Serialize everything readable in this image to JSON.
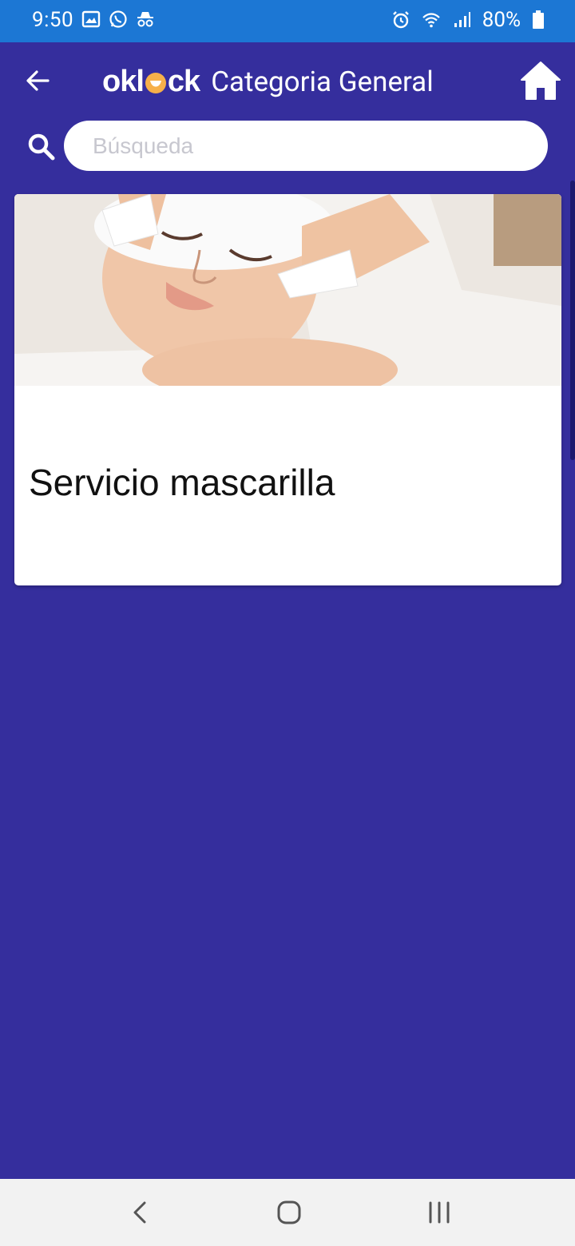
{
  "status_bar": {
    "time": "9:50",
    "battery": "80%",
    "left_icons": [
      "gallery-icon",
      "whatsapp-icon",
      "incognito-icon"
    ],
    "right_icons": [
      "alarm-icon",
      "wifi-icon",
      "signal-icon",
      "battery-icon"
    ]
  },
  "header": {
    "logo_text_left": "okl",
    "logo_text_right": "ck",
    "title": "Categoria General",
    "back_icon": "arrow-left-icon",
    "home_icon": "home-icon"
  },
  "search": {
    "placeholder": "Búsqueda",
    "value": ""
  },
  "cards": [
    {
      "title": "Servicio mascarilla",
      "image": "facial-treatment-photo"
    }
  ],
  "colors": {
    "status_bar": "#1c77d4",
    "background": "#352e9d",
    "logo_accent": "#f6b04a"
  },
  "nav_bar": {
    "buttons": [
      "back-nav-icon",
      "home-nav-icon",
      "recents-nav-icon"
    ]
  }
}
